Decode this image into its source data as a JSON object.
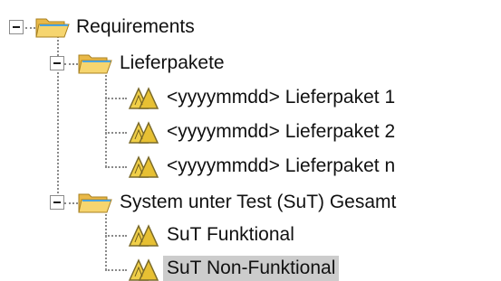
{
  "tree": {
    "nodes": [
      {
        "label": "Requirements",
        "type": "folder",
        "expanded": true,
        "icon": "open-folder-icon"
      },
      {
        "label": "Lieferpakete",
        "type": "folder",
        "expanded": true,
        "icon": "open-folder-icon"
      },
      {
        "label": "<yyyymmdd> Lieferpaket 1",
        "type": "item",
        "icon": "requirement-triangle-icon"
      },
      {
        "label": "<yyyymmdd> Lieferpaket 2",
        "type": "item",
        "icon": "requirement-triangle-icon"
      },
      {
        "label": "<yyyymmdd> Lieferpaket n",
        "type": "item",
        "icon": "requirement-triangle-icon"
      },
      {
        "label": "System unter Test (SuT) Gesamt",
        "type": "folder",
        "expanded": true,
        "icon": "open-folder-icon"
      },
      {
        "label": "SuT Funktional",
        "type": "item",
        "icon": "requirement-triangle-icon"
      },
      {
        "label": "SuT Non-Funktional",
        "type": "item",
        "icon": "requirement-triangle-icon",
        "selected": true
      }
    ]
  },
  "colors": {
    "selection": "#cccccc",
    "folder": "#f3cf62",
    "folder_accent": "#4aa3df",
    "requirement_icon": "#e8c33a"
  }
}
